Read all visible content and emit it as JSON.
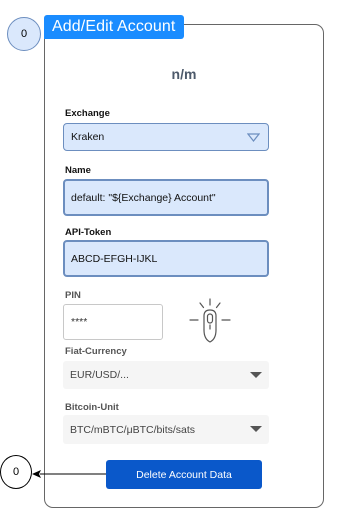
{
  "badges": {
    "top": "0",
    "bottom": "0"
  },
  "title": "Add/Edit Account",
  "subtitle": "n/m",
  "exchange": {
    "label": "Exchange",
    "value": "Kraken"
  },
  "name": {
    "label": "Name",
    "value": "default: \"${Exchange} Account\""
  },
  "api_token": {
    "label": "API-Token",
    "value": "ABCD-EFGH-IJKL"
  },
  "pin": {
    "label": "PIN",
    "value": "****"
  },
  "fiat": {
    "label": "Fiat-Currency",
    "value": "EUR/USD/..."
  },
  "bitcoin_unit": {
    "label": "Bitcoin-Unit",
    "value": "BTC/mBTC/μBTC/bits/sats"
  },
  "delete_button": {
    "label": "Delete Account Data"
  },
  "colors": {
    "accent": "#1a8cff",
    "button": "#0a58ca",
    "field_fill": "#dae8fc",
    "field_border": "#6c8ebf"
  }
}
